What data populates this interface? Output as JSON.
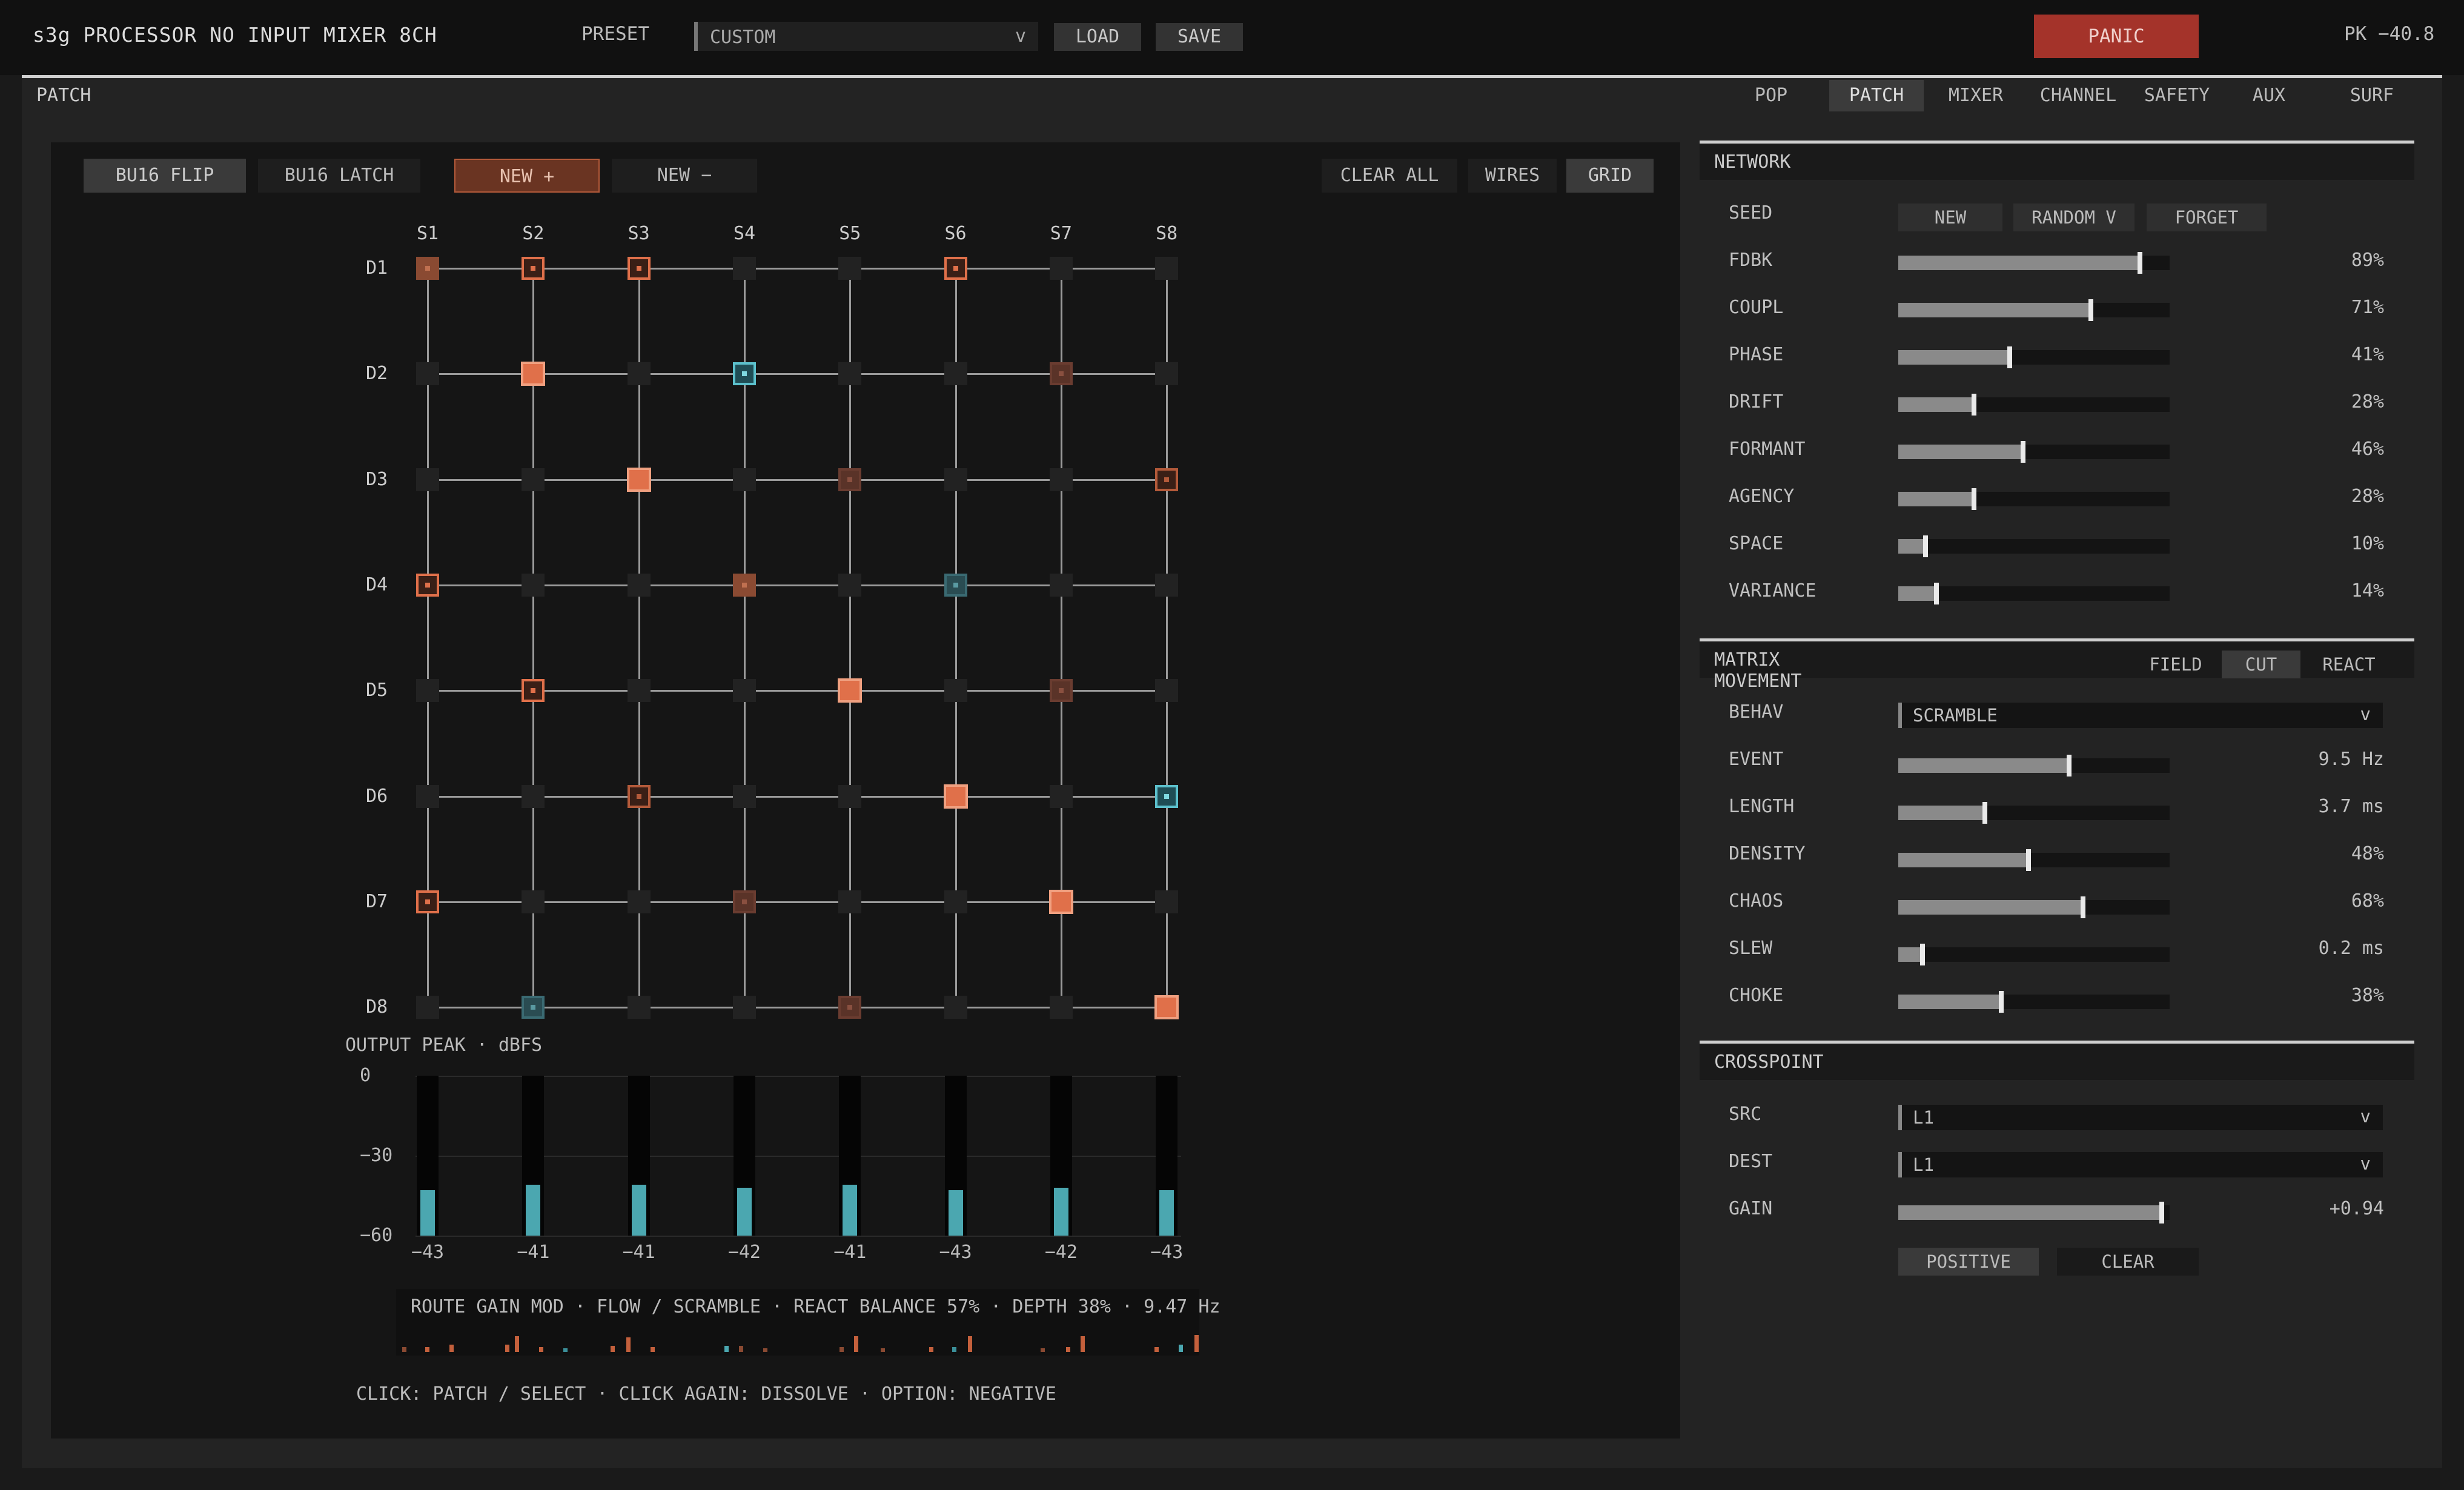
{
  "app": {
    "title": "s3g PROCESSOR NO INPUT MIXER 8CH",
    "preset_label": "PRESET",
    "preset_value": "CUSTOM",
    "preset_chevron": "v",
    "load": "LOAD",
    "save": "SAVE",
    "panic": "PANIC",
    "peak": "PK −40.8"
  },
  "section": {
    "label": "PATCH",
    "tabs": [
      "POP",
      "PATCH",
      "MIXER",
      "CHANNEL",
      "SAFETY",
      "AUX",
      "SURF"
    ],
    "active_tab": "PATCH"
  },
  "grid_toolbar": {
    "bu16_flip": "BU16 FLIP",
    "bu16_latch": "BU16 LATCH",
    "new_plus": "NEW +",
    "new_minus": "NEW −",
    "clear_all": "CLEAR ALL",
    "wires": "WIRES",
    "grid": "GRID"
  },
  "matrix": {
    "sources": [
      "S1",
      "S2",
      "S3",
      "S4",
      "S5",
      "S6",
      "S7",
      "S8"
    ],
    "dests": [
      "D1",
      "D2",
      "D3",
      "D4",
      "D5",
      "D6",
      "D7",
      "D8"
    ],
    "nodes": [
      {
        "d": 0,
        "s": 0,
        "kind": "dark-orange",
        "size": "s"
      },
      {
        "d": 0,
        "s": 1,
        "kind": "outline-orange",
        "size": "s"
      },
      {
        "d": 0,
        "s": 2,
        "kind": "outline-orange",
        "size": "s"
      },
      {
        "d": 0,
        "s": 5,
        "kind": "outline-orange",
        "size": "s"
      },
      {
        "d": 1,
        "s": 1,
        "kind": "orange",
        "size": "m"
      },
      {
        "d": 1,
        "s": 3,
        "kind": "teal",
        "size": "s"
      },
      {
        "d": 1,
        "s": 6,
        "kind": "brown",
        "size": "s"
      },
      {
        "d": 2,
        "s": 2,
        "kind": "orange",
        "size": "m"
      },
      {
        "d": 2,
        "s": 4,
        "kind": "brown",
        "size": "s"
      },
      {
        "d": 2,
        "s": 7,
        "kind": "outline-brown",
        "size": "s"
      },
      {
        "d": 3,
        "s": 0,
        "kind": "outline-orange",
        "size": "s"
      },
      {
        "d": 3,
        "s": 3,
        "kind": "dark-orange",
        "size": "s"
      },
      {
        "d": 3,
        "s": 5,
        "kind": "dark-teal",
        "size": "s"
      },
      {
        "d": 4,
        "s": 1,
        "kind": "outline-orange",
        "size": "s"
      },
      {
        "d": 4,
        "s": 4,
        "kind": "orange",
        "size": "m"
      },
      {
        "d": 4,
        "s": 6,
        "kind": "brown",
        "size": "s"
      },
      {
        "d": 5,
        "s": 2,
        "kind": "outline-brown",
        "size": "s"
      },
      {
        "d": 5,
        "s": 5,
        "kind": "orange",
        "size": "m"
      },
      {
        "d": 5,
        "s": 7,
        "kind": "teal",
        "size": "s"
      },
      {
        "d": 6,
        "s": 0,
        "kind": "outline-orange",
        "size": "s"
      },
      {
        "d": 6,
        "s": 3,
        "kind": "brown",
        "size": "s"
      },
      {
        "d": 6,
        "s": 6,
        "kind": "orange",
        "size": "m"
      },
      {
        "d": 7,
        "s": 1,
        "kind": "dark-teal",
        "size": "s"
      },
      {
        "d": 7,
        "s": 4,
        "kind": "brown",
        "size": "s"
      },
      {
        "d": 7,
        "s": 7,
        "kind": "orange",
        "size": "m"
      }
    ],
    "colors": {
      "orange": "#e0704a",
      "dark_orange": "#8a4a32",
      "brown": "#5a3328",
      "teal": "#3b8f99",
      "dark_teal": "#2a4c52"
    }
  },
  "output": {
    "label": "OUTPUT PEAK · dBFS",
    "axis": [
      "0",
      "−30",
      "−60"
    ],
    "values": [
      "−43",
      "−41",
      "−41",
      "−42",
      "−41",
      "−43",
      "−42",
      "−43"
    ],
    "levels_db": [
      -43,
      -41,
      -41,
      -42,
      -41,
      -43,
      -42,
      -43
    ],
    "range_db": [
      -60,
      0
    ],
    "meter_color": "#4ba7b0"
  },
  "route": {
    "text": "ROUTE GAIN MOD · FLOW / SCRAMBLE · REACT BALANCE 57% · DEPTH 38% · 9.47 Hz"
  },
  "hint": "CLICK: PATCH / SELECT · CLICK AGAIN: DISSOLVE · OPTION: NEGATIVE",
  "network": {
    "title": "NETWORK",
    "seed_label": "SEED",
    "seed_buttons": [
      "NEW",
      "RANDOM V",
      "FORGET"
    ],
    "params": [
      {
        "label": "FDBK",
        "value": "89%",
        "level": 0.89
      },
      {
        "label": "COUPL",
        "value": "71%",
        "level": 0.71
      },
      {
        "label": "PHASE",
        "value": "41%",
        "level": 0.41
      },
      {
        "label": "DRIFT",
        "value": "28%",
        "level": 0.28
      },
      {
        "label": "FORMANT",
        "value": "46%",
        "level": 0.46
      },
      {
        "label": "AGENCY",
        "value": "28%",
        "level": 0.28
      },
      {
        "label": "SPACE",
        "value": "10%",
        "level": 0.1
      },
      {
        "label": "VARIANCE",
        "value": "14%",
        "level": 0.14
      }
    ]
  },
  "movement": {
    "title": "MATRIX MOVEMENT",
    "modes": [
      "FIELD",
      "CUT",
      "REACT"
    ],
    "active_mode": "CUT",
    "behav_label": "BEHAV",
    "behav_value": "SCRAMBLE",
    "chevron": "v",
    "params": [
      {
        "label": "EVENT",
        "value": "9.5 Hz",
        "level": 0.63
      },
      {
        "label": "LENGTH",
        "value": "3.7 ms",
        "level": 0.32
      },
      {
        "label": "DENSITY",
        "value": "48%",
        "level": 0.48
      },
      {
        "label": "CHAOS",
        "value": "68%",
        "level": 0.68
      },
      {
        "label": "SLEW",
        "value": "0.2 ms",
        "level": 0.09
      },
      {
        "label": "CHOKE",
        "value": "38%",
        "level": 0.38
      }
    ]
  },
  "crosspoint": {
    "title": "CROSSPOINT",
    "src_label": "SRC",
    "src_value": "L1",
    "dest_label": "DEST",
    "dest_value": "L1",
    "gain_label": "GAIN",
    "gain_value": "+0.94",
    "gain_level": 0.97,
    "positive": "POSITIVE",
    "clear": "CLEAR",
    "chevron": "v"
  }
}
